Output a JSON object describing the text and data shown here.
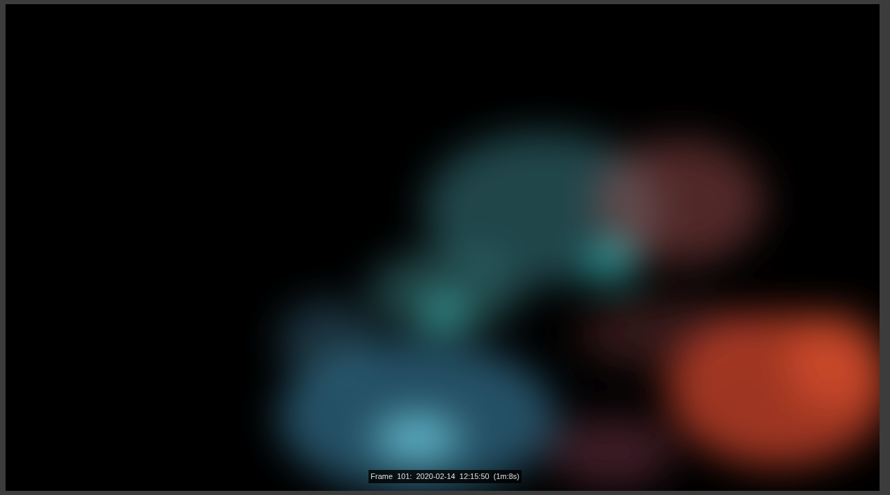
{
  "viewport": {
    "frame_label": "Frame  101:  2020-02-14  12:15:50  (1m:8s)"
  }
}
